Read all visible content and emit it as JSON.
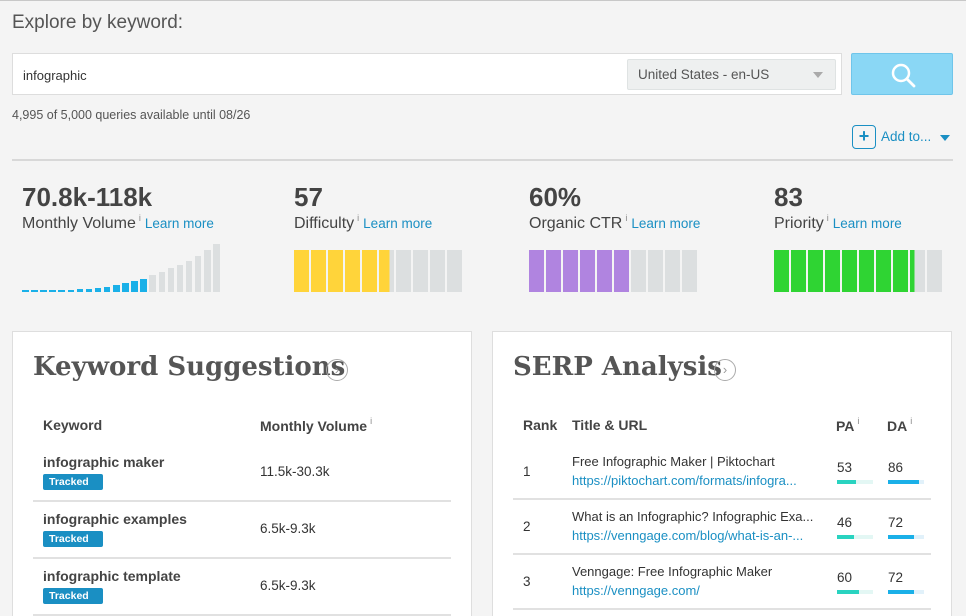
{
  "header": {
    "title": "Explore by keyword:"
  },
  "search": {
    "value": "infographic",
    "locale": "United States - en-US",
    "quota_text": "4,995 of 5,000 queries available until 08/26",
    "add_to_label": "Add to..."
  },
  "metrics": [
    {
      "value": "70.8k-118k",
      "label": "Monthly Volume",
      "info": "i",
      "learn": "Learn more"
    },
    {
      "value": "57",
      "label": "Difficulty",
      "info": "i",
      "learn": "Learn more"
    },
    {
      "value": "60%",
      "label": "Organic CTR",
      "info": "i",
      "learn": "Learn more"
    },
    {
      "value": "83",
      "label": "Priority",
      "info": "i",
      "learn": "Learn more"
    }
  ],
  "colors": {
    "accent": "#1a8fc3",
    "volume": "#1ab0e8",
    "difficulty": "#ffd43a",
    "ctr": "#b084e0",
    "priority": "#2fd433",
    "bar_empty": "#dcdfe0"
  },
  "keyword_suggestions": {
    "title": "Keyword Suggestions",
    "columns": [
      "Keyword",
      "Monthly Volume"
    ],
    "info": "i",
    "rows": [
      {
        "keyword": "infographic maker",
        "badge": "Tracked",
        "volume": "11.5k-30.3k"
      },
      {
        "keyword": "infographic examples",
        "badge": "Tracked",
        "volume": "6.5k-9.3k"
      },
      {
        "keyword": "infographic template",
        "badge": "Tracked",
        "volume": "6.5k-9.3k"
      }
    ]
  },
  "serp_analysis": {
    "title": "SERP Analysis",
    "columns": [
      "Rank",
      "Title & URL",
      "PA",
      "DA"
    ],
    "info": "i",
    "rows": [
      {
        "rank": "1",
        "title": "Free Infographic Maker | Piktochart",
        "url": "https://piktochart.com/formats/infogra...",
        "pa": "53",
        "da": "86"
      },
      {
        "rank": "2",
        "title": "What is an Infographic? Infographic Exa...",
        "url": "https://venngage.com/blog/what-is-an-...",
        "pa": "46",
        "da": "72"
      },
      {
        "rank": "3",
        "title": "Venngage: Free Infographic Maker",
        "url": "https://venngage.com/",
        "pa": "60",
        "da": "72"
      }
    ]
  }
}
